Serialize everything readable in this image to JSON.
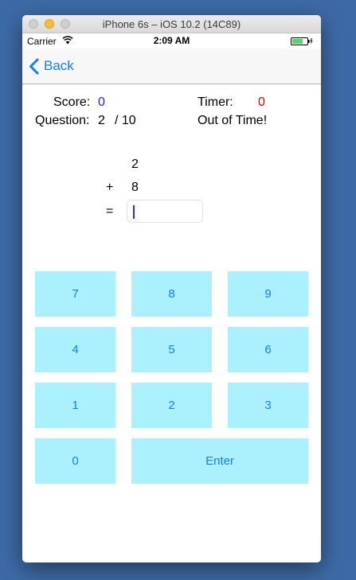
{
  "window": {
    "title": "iPhone 6s – iOS 10.2 (14C89)"
  },
  "status_bar": {
    "carrier": "Carrier",
    "time": "2:09 AM"
  },
  "nav": {
    "back_label": "Back"
  },
  "stats": {
    "score_label": "Score:",
    "score_value": "0",
    "timer_label": "Timer:",
    "timer_value": "0",
    "question_label": "Question:",
    "question_current": "2",
    "question_total": "/ 10",
    "status_message": "Out of Time!"
  },
  "problem": {
    "operand1": "2",
    "operator": "+",
    "operand2": "8",
    "equals": "=",
    "answer_value": ""
  },
  "keypad": {
    "keys": [
      "7",
      "8",
      "9",
      "4",
      "5",
      "6",
      "1",
      "2",
      "3",
      "0"
    ],
    "enter_label": "Enter"
  },
  "colors": {
    "accent": "#147efb",
    "key_background": "#aaf1fd",
    "score_value": "#2a24e0",
    "timer_value": "#e00000"
  }
}
